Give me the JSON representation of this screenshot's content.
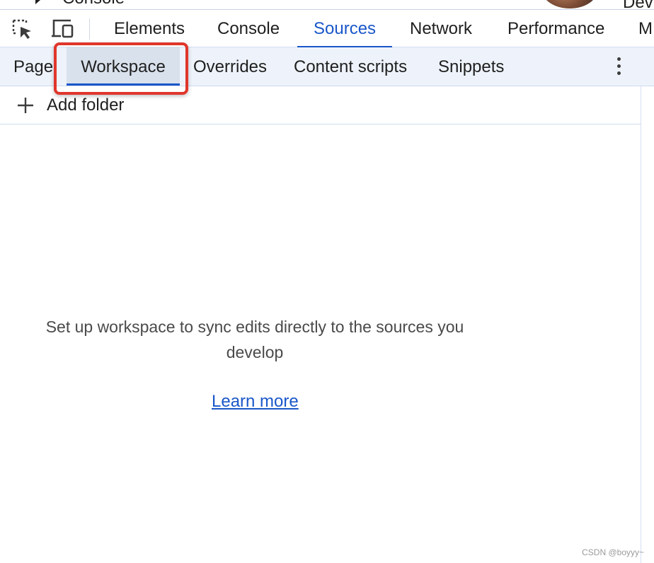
{
  "cropped_header": {
    "left_text": "Console",
    "right_text": "Dev"
  },
  "toolbar": {
    "icons": [
      "inspect-element-icon",
      "device-toolbar-icon"
    ],
    "tabs": [
      {
        "label": "Elements",
        "active": false
      },
      {
        "label": "Console",
        "active": false
      },
      {
        "label": "Sources",
        "active": true
      },
      {
        "label": "Network",
        "active": false
      },
      {
        "label": "Performance",
        "active": false
      },
      {
        "label": "M",
        "active": false
      }
    ]
  },
  "sources_navigator": {
    "tabs": [
      {
        "label": "Page",
        "selected": false
      },
      {
        "label": "Workspace",
        "selected": true
      },
      {
        "label": "Overrides",
        "selected": false
      },
      {
        "label": "Content scripts",
        "selected": false
      },
      {
        "label": "Snippets",
        "selected": false
      }
    ],
    "more_icon": "more-vertical-icon",
    "add_folder_label": "Add folder",
    "add_folder_icon": "plus-icon"
  },
  "workspace_empty": {
    "message": "Set up workspace to sync edits directly to the sources you develop",
    "link_label": "Learn more"
  },
  "watermark": "CSDN @boyyy~",
  "colors": {
    "accent": "#1a57c9",
    "highlight_box": "#e0362b",
    "subbar_bg": "#eef3fb",
    "selected_tab_bg": "#d9e1ec"
  }
}
